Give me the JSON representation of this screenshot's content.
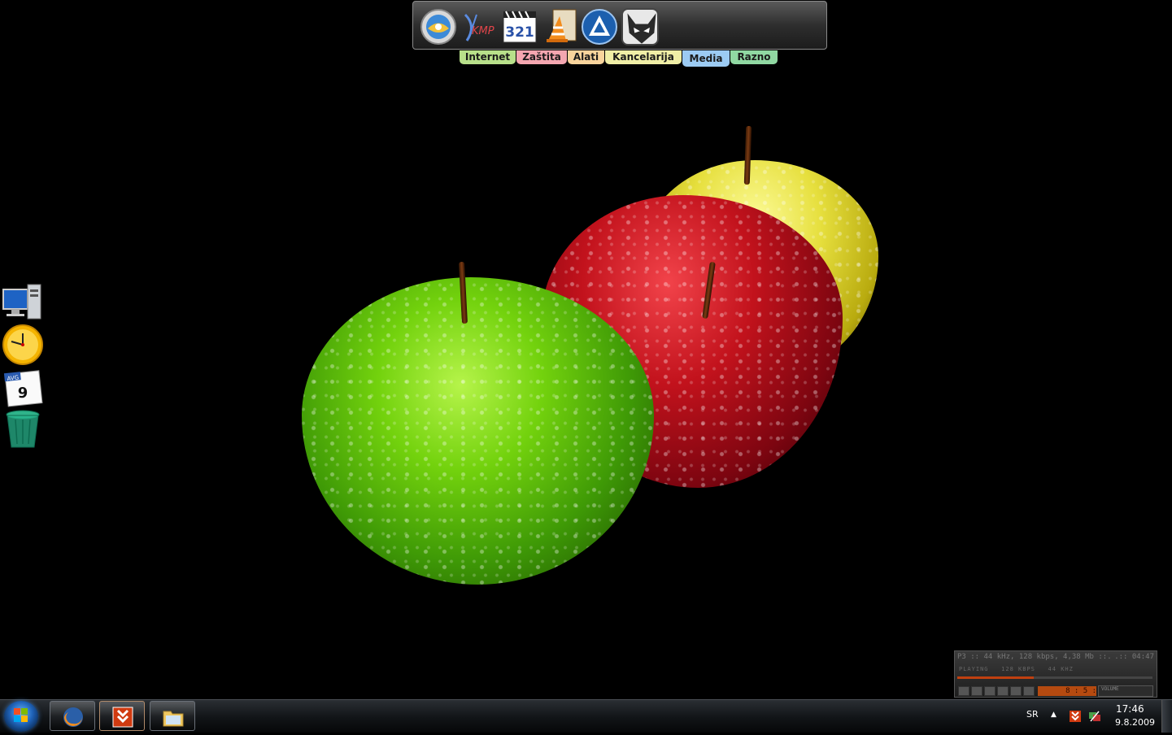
{
  "dock": {
    "icons": [
      {
        "name": "media-center-icon"
      },
      {
        "name": "kmp-player-icon",
        "label": "KMP"
      },
      {
        "name": "media-player-classic-icon",
        "label": "321"
      },
      {
        "name": "vlc-icon"
      },
      {
        "name": "aimp-icon"
      },
      {
        "name": "foobar-icon"
      }
    ],
    "tabs": [
      {
        "label": "Internet",
        "color": "#b8e08a"
      },
      {
        "label": "Zaštita",
        "color": "#f4a6b0"
      },
      {
        "label": "Alati",
        "color": "#f9d49c"
      },
      {
        "label": "Kancelarija",
        "color": "#f0eea6"
      },
      {
        "label": "Media",
        "color": "#9ccbf3",
        "active": true
      },
      {
        "label": "Razno",
        "color": "#90d8a2"
      }
    ]
  },
  "desktop_icons": [
    {
      "name": "computer-icon"
    },
    {
      "name": "clock-gadget-icon"
    },
    {
      "name": "calendar-gadget-icon",
      "month": "AVG",
      "day": "9"
    },
    {
      "name": "recycle-bin-icon"
    }
  ],
  "player": {
    "info": "P3 :: 44 kHz, 128 kbps, 4,38 Mb ::.",
    "elapsed": ".:: 04:47",
    "status": [
      "PLAYING",
      "128 KBPS",
      "44 KHZ"
    ],
    "progress": 0.39,
    "display_time": "8 : 5 :",
    "volume_label": "VOLUME"
  },
  "taskbar": {
    "buttons": [
      {
        "name": "firefox-taskbar-button"
      },
      {
        "name": "downloader-taskbar-button"
      },
      {
        "name": "explorer-taskbar-button"
      }
    ],
    "language": "SR",
    "time": "17:46",
    "date": "9.8.2009"
  }
}
